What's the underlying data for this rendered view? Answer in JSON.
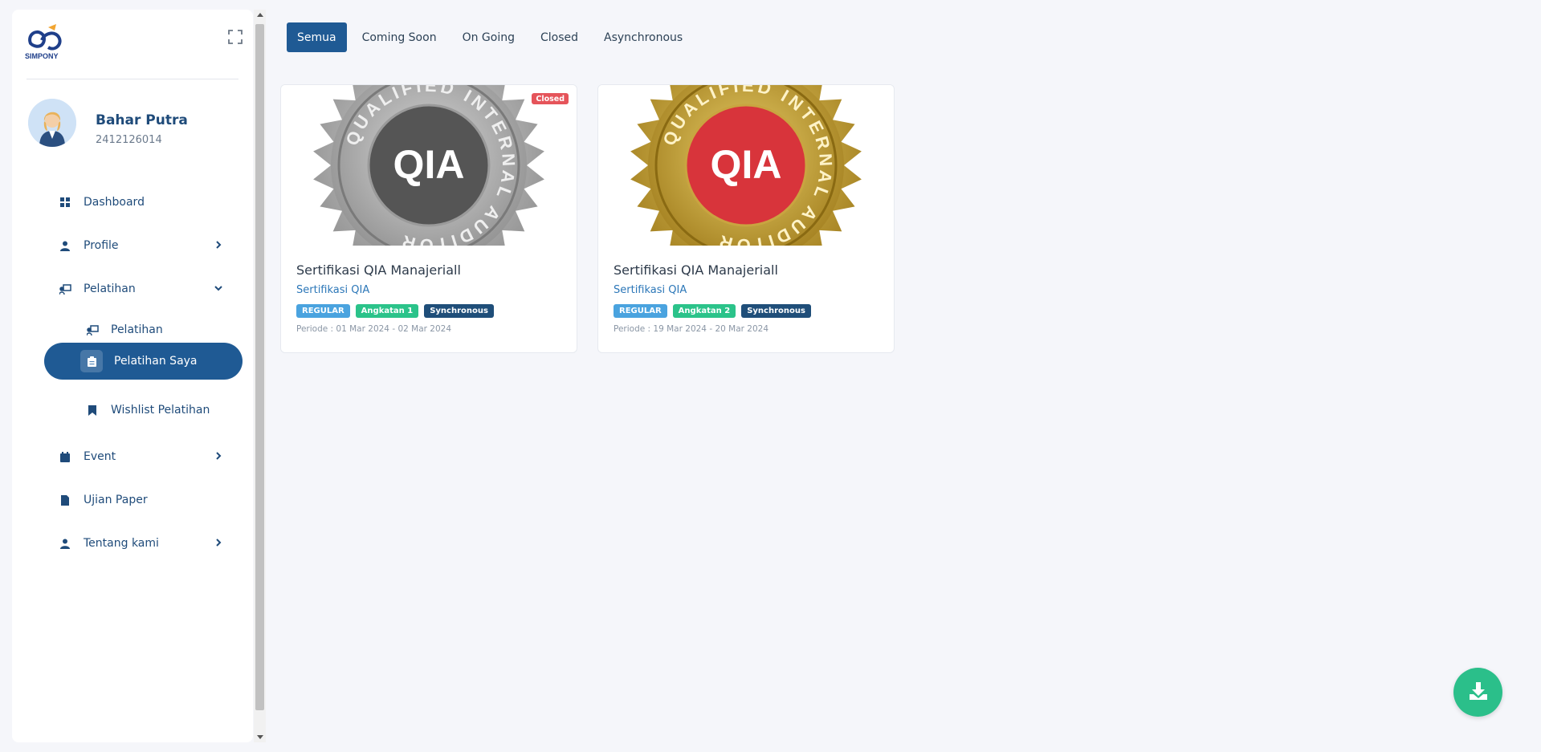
{
  "brand": {
    "logo_text": "SIMPONY"
  },
  "user": {
    "name": "Bahar Putra",
    "id": "2412126014"
  },
  "nav": {
    "dashboard": "Dashboard",
    "profile": "Profile",
    "pelatihan": "Pelatihan",
    "pelatihan_sub": "Pelatihan",
    "pelatihan_saya": "Pelatihan Saya",
    "wishlist": "Wishlist Pelatihan",
    "event": "Event",
    "ujian": "Ujian Paper",
    "tentang": "Tentang kami"
  },
  "tabs": [
    "Semua",
    "Coming Soon",
    "On Going",
    "Closed",
    "Asynchronous"
  ],
  "active_tab": "Semua",
  "cards": [
    {
      "title": "Sertifikasi QIA Manajeriall",
      "subtitle": "Sertifikasi QIA",
      "badges": [
        "REGULAR",
        "Angkatan 1",
        "Synchronous"
      ],
      "period": "Periode : 01 Mar 2024 - 02 Mar 2024",
      "status": "Closed",
      "seal_text": "QIA",
      "seal_ring": "QUALIFIED INTERNAL AUDITOR",
      "theme": "silver"
    },
    {
      "title": "Sertifikasi QIA Manajeriall",
      "subtitle": "Sertifikasi QIA",
      "badges": [
        "REGULAR",
        "Angkatan 2",
        "Synchronous"
      ],
      "period": "Periode : 19 Mar 2024 - 20 Mar 2024",
      "status": "",
      "seal_text": "QIA",
      "seal_ring": "QUALIFIED INTERNAL AUDITOR",
      "theme": "gold"
    }
  ],
  "colors": {
    "primary": "#1f5a94",
    "accent_green": "#2bbf8a",
    "closed_red": "#e5545a"
  }
}
